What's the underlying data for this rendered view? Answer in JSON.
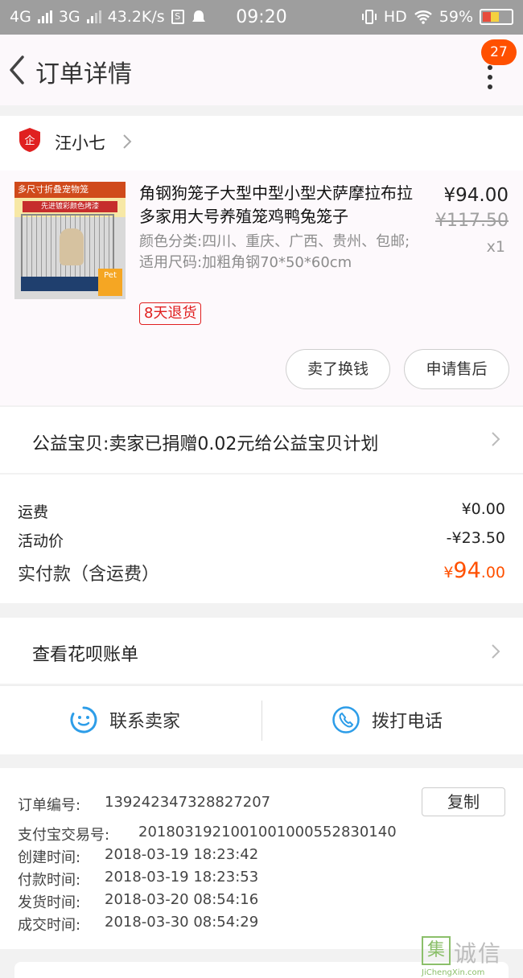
{
  "status_bar": {
    "net1": "4G",
    "net2": "3G",
    "speed": "43.2K/s",
    "time": "09:20",
    "hd": "HD",
    "battery": "59%",
    "battery_level": 0.59
  },
  "header": {
    "title": "订单详情",
    "badge": "27"
  },
  "shop": {
    "logo_text": "企",
    "name": "汪小七"
  },
  "item": {
    "image_top_text": "多尺寸折叠宠物笼",
    "image_sub_text": "先进镀彩颜色烤漆",
    "image_badge": "Pet",
    "title": "角钢狗笼子大型中型小型犬萨摩拉布拉多家用大号养殖笼鸡鸭兔笼子",
    "sku": "颜色分类:四川、重庆、广西、贵州、包邮;适用尺码:加粗角钢70*50*60cm",
    "price": "¥94.00",
    "original_price": "¥117.50",
    "quantity": "x1",
    "return_tag": "8天退货",
    "btn_sell": "卖了换钱",
    "btn_after_sale": "申请售后"
  },
  "charity": {
    "text": "公益宝贝:卖家已捐赠0.02元给公益宝贝计划"
  },
  "fees": {
    "shipping_label": "运费",
    "shipping_value": "¥0.00",
    "discount_label": "活动价",
    "discount_value": "-¥23.50",
    "total_label": "实付款（含运费）",
    "total_currency": "¥",
    "total_integer": "94",
    "total_decimal": ".00"
  },
  "huabei": {
    "text": "查看花呗账单"
  },
  "contact": {
    "seller": "联系卖家",
    "phone": "拨打电话"
  },
  "order_info": {
    "order_no_label": "订单编号:",
    "order_no": "1392423473288272​07",
    "copy": "复制",
    "alipay_label": "支付宝交易号:",
    "alipay_no": "2018031921001001000552830140",
    "created_label": "创建时间:",
    "created": "2018-03-19 18:23:42",
    "paid_label": "付款时间:",
    "paid": "2018-03-19 18:23:53",
    "shipped_label": "发货时间:",
    "shipped": "2018-03-20 08:54:16",
    "done_label": "成交时间:",
    "done": "2018-03-30 08:54:29"
  },
  "watermark": {
    "box": "集",
    "text": "诚信",
    "url": "JiChengXin.com"
  },
  "colors": {
    "accent": "#ff5000",
    "tag_red": "#e02020",
    "icon_blue": "#2d9de8"
  }
}
